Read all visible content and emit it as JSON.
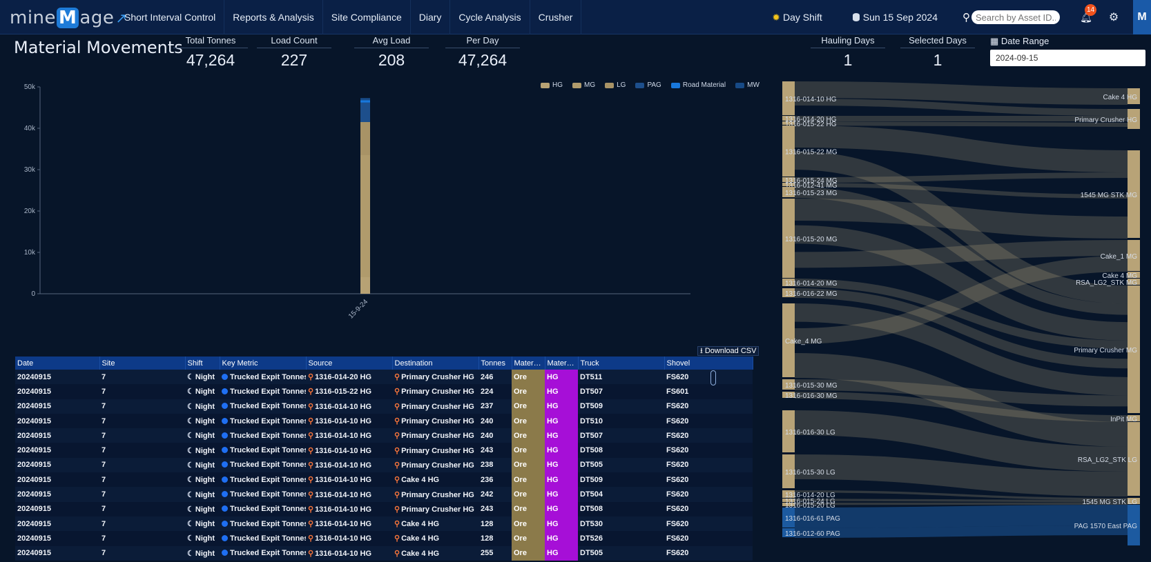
{
  "app": {
    "logo_part1": "mine",
    "logo_part2": "M",
    "logo_part3": "age",
    "nav": [
      "Short Interval Control",
      "Reports & Analysis",
      "Site Compliance",
      "Diary",
      "Cycle Analysis",
      "Crusher"
    ],
    "shift_label": "Day Shift",
    "current_date": "Sun 15 Sep 2024",
    "search_placeholder": "Search by Asset ID...",
    "notification_count": "14",
    "user_initial": "M"
  },
  "page": {
    "title": "Material Movements",
    "kpis": [
      {
        "label": "Total Tonnes",
        "value": "47,264"
      },
      {
        "label": "Load Count",
        "value": "227"
      },
      {
        "label": "Avg Load",
        "value": "208"
      },
      {
        "label": "Per Day",
        "value": "47,264"
      },
      {
        "label": "Hauling Days",
        "value": "1"
      },
      {
        "label": "Selected Days",
        "value": "1"
      }
    ],
    "date_range_label": "Date Range",
    "date_range_value": "2024-09-15",
    "download_label": "Download CSV"
  },
  "colors": {
    "HG": "#b7a274",
    "MG": "#b09b6c",
    "LG": "#a89366",
    "PAG": "#1d4f8c",
    "Road Material": "#1878dc",
    "MW": "#174a86"
  },
  "chart_data": {
    "type": "bar",
    "stacked": true,
    "categories": [
      "15-9-24"
    ],
    "series": [
      {
        "name": "HG",
        "values": [
          4000
        ]
      },
      {
        "name": "MG",
        "values": [
          29500
        ]
      },
      {
        "name": "LG",
        "values": [
          8000
        ]
      },
      {
        "name": "PAG",
        "values": [
          4700
        ]
      },
      {
        "name": "Road Material",
        "values": [
          600
        ]
      },
      {
        "name": "MW",
        "values": [
          500
        ]
      }
    ],
    "ylim": [
      0,
      50000
    ],
    "yticks": [
      "0",
      "10k",
      "20k",
      "30k",
      "40k",
      "50k"
    ],
    "legend_position": "top-right"
  },
  "sankey": {
    "sources": [
      "1316-014-10 HG",
      "1316-014-20 HG",
      "1316-015-22 HG",
      "1316-015-22 MG",
      "1316-015-24 MG",
      "1316-012-41 MG",
      "1316-015-23 MG",
      "1316-015-20 MG",
      "1316-014-20 MG",
      "1316-016-22 MG",
      "Cake_4 MG",
      "1316-015-30 MG",
      "1316-016-30 MG",
      "1316-016-30 LG",
      "1316-015-30 LG",
      "1316-014-20 LG",
      "1316-015-24 LG",
      "1316-015-20 LG",
      "1316-016-61 PAG",
      "1316-012-60 PAG"
    ],
    "destinations": [
      "Cake 4 HG",
      "Primary Crusher HG",
      "1545 MG STK MG",
      "Cake_1 MG",
      "Cake 4 MG",
      "RSA_LG2_STK MG",
      "Primary Crusher MG",
      "InPit MG",
      "RSA_LG2_STK LG",
      "1545 MG STK LG",
      "PAG 1570 East PAG"
    ]
  },
  "table": {
    "columns": [
      "Date",
      "Site",
      "Shift",
      "Key Metric",
      "Source",
      "Destination",
      "Tonnes",
      "Material Type",
      "Material Grade",
      "Truck",
      "Shovel"
    ],
    "rows": [
      [
        "20240915",
        "7",
        "Night",
        "Trucked Expit Tonnes",
        "1316-014-20 HG",
        "Primary Crusher HG",
        "246",
        "Ore",
        "HG",
        "DT511",
        "FS620"
      ],
      [
        "20240915",
        "7",
        "Night",
        "Trucked Expit Tonnes",
        "1316-015-22 HG",
        "Primary Crusher HG",
        "224",
        "Ore",
        "HG",
        "DT507",
        "FS601"
      ],
      [
        "20240915",
        "7",
        "Night",
        "Trucked Expit Tonnes",
        "1316-014-10 HG",
        "Primary Crusher HG",
        "237",
        "Ore",
        "HG",
        "DT509",
        "FS620"
      ],
      [
        "20240915",
        "7",
        "Night",
        "Trucked Expit Tonnes",
        "1316-014-10 HG",
        "Primary Crusher HG",
        "240",
        "Ore",
        "HG",
        "DT510",
        "FS620"
      ],
      [
        "20240915",
        "7",
        "Night",
        "Trucked Expit Tonnes",
        "1316-014-10 HG",
        "Primary Crusher HG",
        "240",
        "Ore",
        "HG",
        "DT507",
        "FS620"
      ],
      [
        "20240915",
        "7",
        "Night",
        "Trucked Expit Tonnes",
        "1316-014-10 HG",
        "Primary Crusher HG",
        "243",
        "Ore",
        "HG",
        "DT508",
        "FS620"
      ],
      [
        "20240915",
        "7",
        "Night",
        "Trucked Expit Tonnes",
        "1316-014-10 HG",
        "Primary Crusher HG",
        "238",
        "Ore",
        "HG",
        "DT505",
        "FS620"
      ],
      [
        "20240915",
        "7",
        "Night",
        "Trucked Expit Tonnes",
        "1316-014-10 HG",
        "Cake 4 HG",
        "236",
        "Ore",
        "HG",
        "DT509",
        "FS620"
      ],
      [
        "20240915",
        "7",
        "Night",
        "Trucked Expit Tonnes",
        "1316-014-10 HG",
        "Primary Crusher HG",
        "242",
        "Ore",
        "HG",
        "DT504",
        "FS620"
      ],
      [
        "20240915",
        "7",
        "Night",
        "Trucked Expit Tonnes",
        "1316-014-10 HG",
        "Primary Crusher HG",
        "243",
        "Ore",
        "HG",
        "DT508",
        "FS620"
      ],
      [
        "20240915",
        "7",
        "Night",
        "Trucked Expit Tonnes",
        "1316-014-10 HG",
        "Cake 4 HG",
        "128",
        "Ore",
        "HG",
        "DT530",
        "FS620"
      ],
      [
        "20240915",
        "7",
        "Night",
        "Trucked Expit Tonnes",
        "1316-014-10 HG",
        "Cake 4 HG",
        "128",
        "Ore",
        "HG",
        "DT526",
        "FS620"
      ],
      [
        "20240915",
        "7",
        "Night",
        "Trucked Expit Tonnes",
        "1316-014-10 HG",
        "Cake 4 HG",
        "255",
        "Ore",
        "HG",
        "DT505",
        "FS620"
      ]
    ]
  }
}
